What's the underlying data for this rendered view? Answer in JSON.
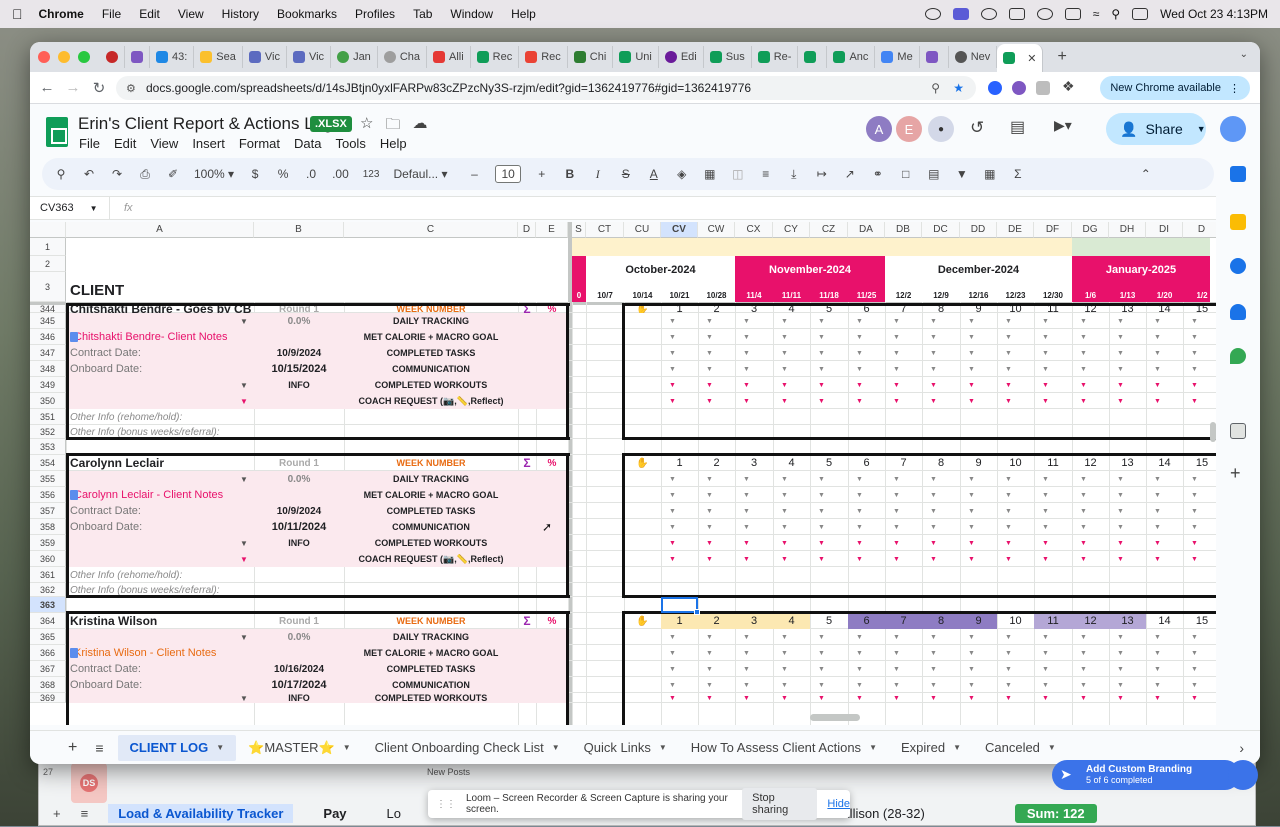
{
  "menubar": {
    "app": "Chrome",
    "items": [
      "File",
      "Edit",
      "View",
      "History",
      "Bookmarks",
      "Profiles",
      "Tab",
      "Window",
      "Help"
    ],
    "clock": "Wed Oct 23  4:13PM"
  },
  "tabs": [
    "43:",
    "Sea",
    "Vic",
    "Vic",
    "Jan",
    "Cha",
    "Alli",
    "Rec",
    "Rec",
    "Chi",
    "Uni",
    "Edi",
    "Sus",
    "Re-",
    "",
    "Anc",
    "Me",
    "",
    "Nev"
  ],
  "tab_close": "✕",
  "tab_new": "+",
  "address": {
    "url": "docs.google.com/spreadsheets/d/14sJBtjn0yxlFARPw83cZPzcNy3S-rzjm/edit?gid=1362419776#gid=1362419776",
    "update_label": "New Chrome available"
  },
  "doc": {
    "title": "Erin's Client Report & Actions Log",
    "badge": ".XLSX",
    "menu": [
      "File",
      "Edit",
      "View",
      "Insert",
      "Format",
      "Data",
      "Tools",
      "Help"
    ],
    "share": "Share",
    "avatars": [
      "A",
      "E"
    ]
  },
  "toolbar": {
    "zoom": "100%",
    "currency": "$",
    "percent": "%",
    "dec_down": ".0",
    "dec_up": ".00",
    "num_format": "123",
    "font": "Defaul...",
    "font_size": "10",
    "bold": "B",
    "italic": "I",
    "strike": "S",
    "text_color": "A",
    "minus": "–",
    "plus": "+"
  },
  "formula": {
    "namebox": "CV363",
    "fx": "fx"
  },
  "columns": {
    "left": [
      {
        "id": "A",
        "label": "A"
      },
      {
        "id": "B",
        "label": "B"
      },
      {
        "id": "C",
        "label": "C"
      },
      {
        "id": "D",
        "label": "D"
      },
      {
        "id": "E",
        "label": "E"
      }
    ],
    "right": [
      "S",
      "CT",
      "CU",
      "CV",
      "CW",
      "CX",
      "CY",
      "CZ",
      "DA",
      "DB",
      "DC",
      "DD",
      "DE",
      "DF",
      "DG",
      "DH",
      "DI",
      "D"
    ],
    "selected": "CV"
  },
  "header_rows": {
    "r1": "1",
    "r2": "2",
    "r3": "3",
    "client": "CLIENT",
    "months": [
      "October-2024",
      "November-2024",
      "December-2024",
      "January-2025"
    ],
    "weeks": [
      "0",
      "10/7",
      "10/14",
      "10/21",
      "10/28",
      "11/4",
      "11/11",
      "11/18",
      "11/25",
      "12/2",
      "12/9",
      "12/16",
      "12/23",
      "12/30",
      "1/6",
      "1/13",
      "1/20",
      "1/2"
    ]
  },
  "rows": [
    "344",
    "345",
    "346",
    "347",
    "348",
    "349",
    "350",
    "351",
    "352",
    "353",
    "354",
    "355",
    "356",
    "357",
    "358",
    "359",
    "360",
    "361",
    "362",
    "363",
    "364",
    "365",
    "366",
    "367",
    "368",
    "369"
  ],
  "labels": {
    "round": "Round 1",
    "pct": "0.0%",
    "contract": "Contract Date:",
    "onboard": "Onboard Date:",
    "info": "INFO",
    "other1": "Other Info (rehome/hold):",
    "other2": "Other Info (bonus weeks/referral):",
    "sigma": "Σ",
    "percent": "%",
    "categories": [
      "WEEK NUMBER",
      "DAILY TRACKING",
      "MET CALORIE + MACRO GOAL",
      "COMPLETED TASKS",
      "COMMUNICATION",
      "COMPLETED WORKOUTS",
      "COACH REQUEST (📷,📏,Reflect)"
    ],
    "week_nums": [
      "1",
      "2",
      "3",
      "4",
      "5",
      "6",
      "7",
      "8",
      "9",
      "10",
      "11",
      "12",
      "13",
      "14",
      "15"
    ]
  },
  "clients": [
    {
      "name": "Chitshakti Bendre - Goes by CB",
      "notes": "Chitshakti Bendre- Client Notes",
      "contract": "10/9/2024",
      "onboard": "10/15/2024"
    },
    {
      "name": "Carolynn Leclair",
      "notes": "Carolynn Leclair - Client Notes",
      "contract": "10/9/2024",
      "onboard": "10/11/2024"
    },
    {
      "name": "Kristina Wilson",
      "notes": "Kristina Wilson - Client Notes",
      "contract": "10/16/2024",
      "onboard": "10/17/2024"
    }
  ],
  "sheet_tabs": [
    "CLIENT LOG",
    "⭐MASTER⭐",
    "Client Onboarding Check List",
    "Quick Links",
    "How To Assess Client Actions",
    "Expired",
    "Canceled"
  ],
  "back_window": {
    "tabs": [
      "Load & Availability Tracker",
      "Pay",
      "Lo",
      "Allison (28-32)",
      "Sum: 122"
    ],
    "row": "27",
    "row_avatar": "DS",
    "new_posts": "New Posts"
  },
  "loom": {
    "text": "Loom – Screen Recorder & Screen Capture is sharing your screen.",
    "stop": "Stop sharing",
    "hide": "Hide"
  },
  "branding": {
    "title": "Add Custom Branding",
    "sub": "5 of 6 completed"
  },
  "colors": {
    "pink": "#e8116b",
    "week_orange": "#e86b12",
    "sheets_green": "#0f9d58",
    "purple": "#8e7cc3"
  }
}
